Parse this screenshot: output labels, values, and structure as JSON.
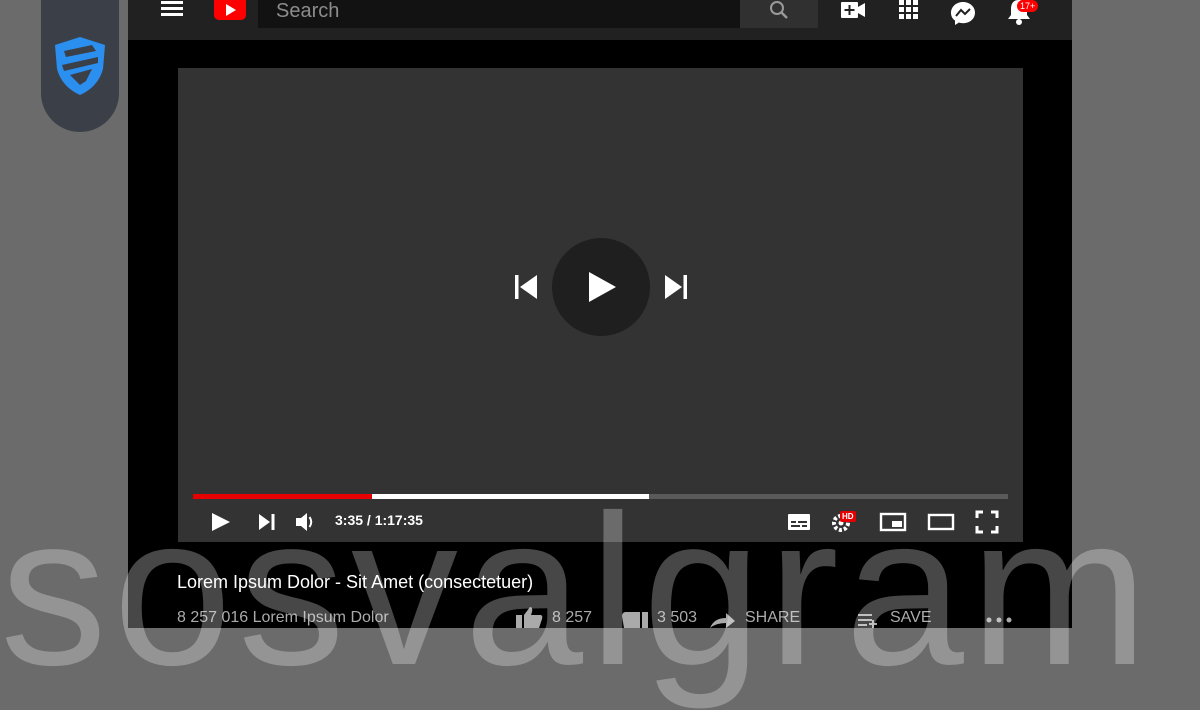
{
  "header": {
    "search_placeholder": "Search",
    "notification_count": "17+"
  },
  "player": {
    "current_time": "3:35",
    "duration": "1:17:35",
    "time_display": "3:35 / 1:17:35",
    "played_fraction": 0.22,
    "buffered_fraction": 0.56,
    "quality_badge": "HD"
  },
  "video": {
    "title": "Lorem Ipsum Dolor - Sit Amet (consectetuer)",
    "views_text": "8 257 016 Lorem Ipsum Dolor",
    "likes": "8 257",
    "dislikes": "3 503",
    "share_label": "SHARE",
    "save_label": "SAVE"
  },
  "watermark": "sosvalgram",
  "colors": {
    "accent_red": "#ff0000",
    "progress_red": "#e60000",
    "shield_blue": "#2b8ff0"
  },
  "icons": [
    "menu-icon",
    "youtube-logo-icon",
    "search-icon",
    "video-camera-plus-icon",
    "apps-grid-icon",
    "messenger-icon",
    "bell-icon",
    "previous-icon",
    "play-icon",
    "next-icon",
    "volume-icon",
    "subtitles-icon",
    "settings-gear-icon",
    "miniplayer-icon",
    "theater-icon",
    "fullscreen-icon",
    "thumbs-up-icon",
    "thumbs-down-icon",
    "share-arrow-icon",
    "playlist-add-icon",
    "more-icon",
    "shield-logo-icon"
  ]
}
